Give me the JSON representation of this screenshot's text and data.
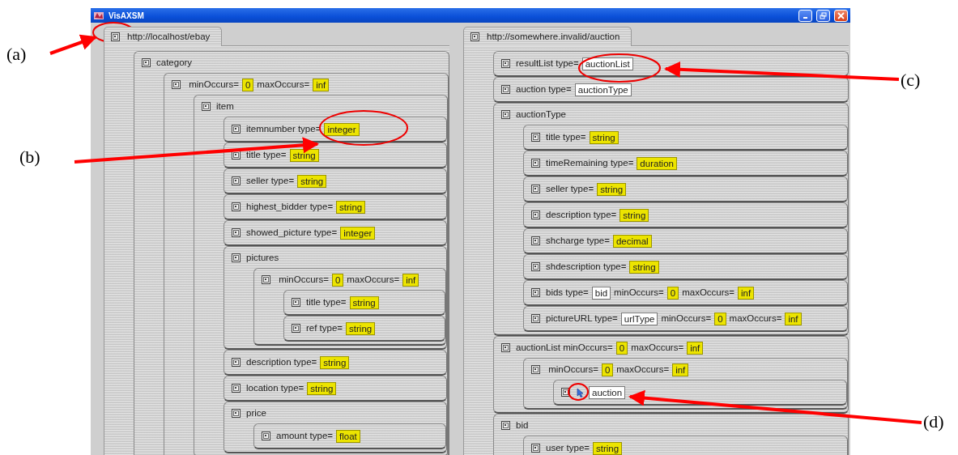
{
  "window": {
    "title": "VisAXSM"
  },
  "panels": [
    {
      "tab": "http://localhost/ebay",
      "nodes": [
        {
          "label": [
            {
              "kind": "text",
              "text": "category"
            }
          ],
          "children": [
            {
              "label": [
                {
                  "kind": "text",
                  "text": " minOccurs="
                },
                {
                  "kind": "builtin",
                  "text": "0"
                },
                {
                  "kind": "text",
                  "text": "maxOccurs="
                },
                {
                  "kind": "builtin",
                  "text": "inf"
                }
              ],
              "children": [
                {
                  "label": [
                    {
                      "kind": "text",
                      "text": "item"
                    }
                  ],
                  "children": [
                    {
                      "label": [
                        {
                          "kind": "text",
                          "text": "itemnumber type="
                        },
                        {
                          "kind": "builtin",
                          "text": "integer"
                        }
                      ]
                    },
                    {
                      "label": [
                        {
                          "kind": "text",
                          "text": "title type="
                        },
                        {
                          "kind": "builtin",
                          "text": "string"
                        }
                      ]
                    },
                    {
                      "label": [
                        {
                          "kind": "text",
                          "text": "seller type="
                        },
                        {
                          "kind": "builtin",
                          "text": "string"
                        }
                      ]
                    },
                    {
                      "label": [
                        {
                          "kind": "text",
                          "text": "highest_bidder type="
                        },
                        {
                          "kind": "builtin",
                          "text": "string"
                        }
                      ]
                    },
                    {
                      "label": [
                        {
                          "kind": "text",
                          "text": "showed_picture type="
                        },
                        {
                          "kind": "builtin",
                          "text": "integer"
                        }
                      ]
                    },
                    {
                      "label": [
                        {
                          "kind": "text",
                          "text": "pictures"
                        }
                      ],
                      "children": [
                        {
                          "label": [
                            {
                              "kind": "text",
                              "text": " minOccurs="
                            },
                            {
                              "kind": "builtin",
                              "text": "0"
                            },
                            {
                              "kind": "text",
                              "text": "maxOccurs="
                            },
                            {
                              "kind": "builtin",
                              "text": "inf"
                            }
                          ],
                          "children": [
                            {
                              "label": [
                                {
                                  "kind": "text",
                                  "text": "title type="
                                },
                                {
                                  "kind": "builtin",
                                  "text": "string"
                                }
                              ]
                            },
                            {
                              "label": [
                                {
                                  "kind": "text",
                                  "text": "ref type="
                                },
                                {
                                  "kind": "builtin",
                                  "text": "string"
                                }
                              ]
                            }
                          ]
                        }
                      ]
                    },
                    {
                      "label": [
                        {
                          "kind": "text",
                          "text": "description type="
                        },
                        {
                          "kind": "builtin",
                          "text": "string"
                        }
                      ]
                    },
                    {
                      "label": [
                        {
                          "kind": "text",
                          "text": "location type="
                        },
                        {
                          "kind": "builtin",
                          "text": "string"
                        }
                      ]
                    },
                    {
                      "label": [
                        {
                          "kind": "text",
                          "text": "price"
                        }
                      ],
                      "children": [
                        {
                          "label": [
                            {
                              "kind": "text",
                              "text": "amount type="
                            },
                            {
                              "kind": "builtin",
                              "text": "float"
                            }
                          ]
                        }
                      ]
                    }
                  ]
                }
              ]
            }
          ]
        }
      ]
    },
    {
      "tab": "http://somewhere.invalid/auction",
      "nodes": [
        {
          "label": [
            {
              "kind": "text",
              "text": "resultList type="
            },
            {
              "kind": "ref",
              "text": "auctionList",
              "linked": false
            }
          ]
        },
        {
          "label": [
            {
              "kind": "text",
              "text": "auction type="
            },
            {
              "kind": "ref",
              "text": "auctionType",
              "linked": false
            }
          ]
        },
        {
          "label": [
            {
              "kind": "text",
              "text": "auctionType"
            }
          ],
          "children": [
            {
              "label": [
                {
                  "kind": "text",
                  "text": "title type="
                },
                {
                  "kind": "builtin",
                  "text": "string"
                }
              ]
            },
            {
              "label": [
                {
                  "kind": "text",
                  "text": "timeRemaining type="
                },
                {
                  "kind": "builtin",
                  "text": "duration"
                }
              ]
            },
            {
              "label": [
                {
                  "kind": "text",
                  "text": "seller type="
                },
                {
                  "kind": "builtin",
                  "text": "string"
                }
              ]
            },
            {
              "label": [
                {
                  "kind": "text",
                  "text": "description type="
                },
                {
                  "kind": "builtin",
                  "text": "string"
                }
              ]
            },
            {
              "label": [
                {
                  "kind": "text",
                  "text": "shcharge type="
                },
                {
                  "kind": "builtin",
                  "text": "decimal"
                }
              ]
            },
            {
              "label": [
                {
                  "kind": "text",
                  "text": "shdescription type="
                },
                {
                  "kind": "builtin",
                  "text": "string"
                }
              ]
            },
            {
              "label": [
                {
                  "kind": "text",
                  "text": "bids type="
                },
                {
                  "kind": "ref",
                  "text": "bid",
                  "linked": false
                },
                {
                  "kind": "text",
                  "text": "minOccurs="
                },
                {
                  "kind": "builtin",
                  "text": "0"
                },
                {
                  "kind": "text",
                  "text": "maxOccurs="
                },
                {
                  "kind": "builtin",
                  "text": "inf"
                }
              ]
            },
            {
              "label": [
                {
                  "kind": "text",
                  "text": "pictureURL type="
                },
                {
                  "kind": "ref",
                  "text": "urlType",
                  "linked": false
                },
                {
                  "kind": "text",
                  "text": "minOccurs="
                },
                {
                  "kind": "builtin",
                  "text": "0"
                },
                {
                  "kind": "text",
                  "text": "maxOccurs="
                },
                {
                  "kind": "builtin",
                  "text": "inf"
                }
              ]
            }
          ]
        },
        {
          "label": [
            {
              "kind": "text",
              "text": "auctionList minOccurs="
            },
            {
              "kind": "builtin",
              "text": "0"
            },
            {
              "kind": "text",
              "text": "maxOccurs="
            },
            {
              "kind": "builtin",
              "text": "inf"
            }
          ],
          "children": [
            {
              "label": [
                {
                  "kind": "text",
                  "text": " minOccurs="
                },
                {
                  "kind": "builtin",
                  "text": "0"
                },
                {
                  "kind": "text",
                  "text": "maxOccurs="
                },
                {
                  "kind": "builtin",
                  "text": "inf"
                }
              ],
              "children": [
                {
                  "label": [
                    {
                      "kind": "ref",
                      "text": "auction",
                      "linked": true
                    }
                  ]
                }
              ]
            }
          ]
        },
        {
          "label": [
            {
              "kind": "text",
              "text": "bid"
            }
          ],
          "children": [
            {
              "label": [
                {
                  "kind": "text",
                  "text": "user type="
                },
                {
                  "kind": "builtin",
                  "text": "string"
                }
              ]
            }
          ]
        }
      ]
    }
  ],
  "annotations": [
    {
      "label": "(a)"
    },
    {
      "label": "(b)"
    },
    {
      "label": "(c)"
    },
    {
      "label": "(d)"
    }
  ]
}
